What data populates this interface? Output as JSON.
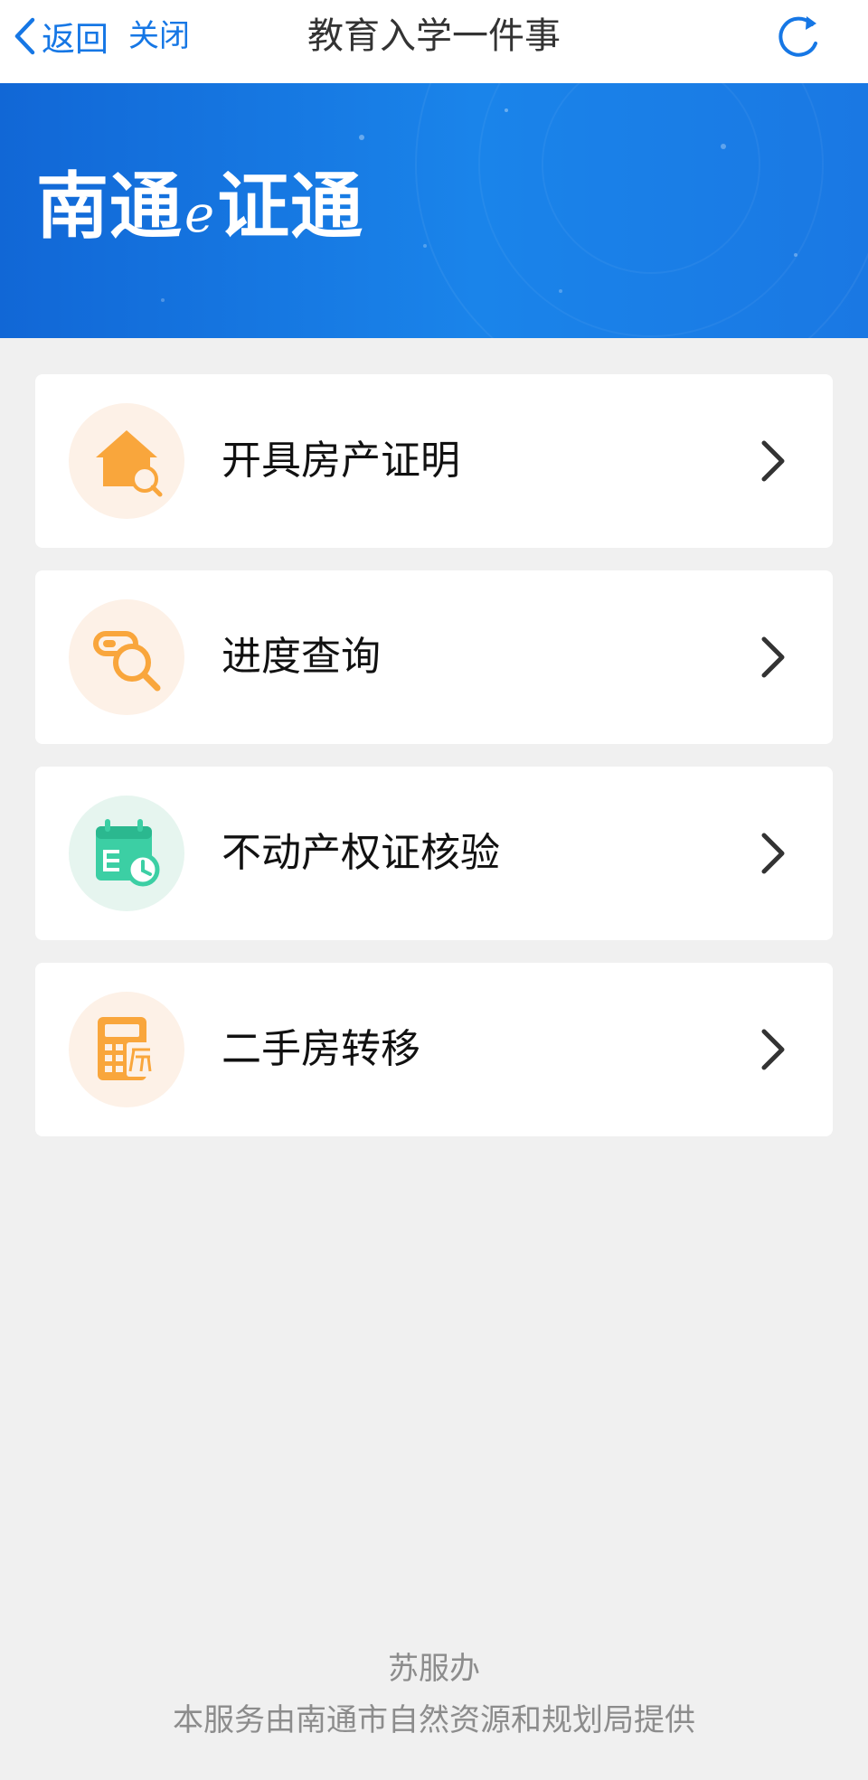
{
  "nav": {
    "back_label": "返回",
    "close_label": "关闭",
    "title": "教育入学一件事"
  },
  "banner": {
    "logo_part1": "南通",
    "logo_e": "e",
    "logo_part2": "证通"
  },
  "menu": [
    {
      "label": "开具房产证明",
      "icon": "house-search-icon"
    },
    {
      "label": "进度查询",
      "icon": "progress-search-icon"
    },
    {
      "label": "不动产权证核验",
      "icon": "calendar-clock-icon"
    },
    {
      "label": "二手房转移",
      "icon": "calculator-house-icon"
    }
  ],
  "footer": {
    "line1": "苏服办",
    "line2": "本服务由南通市自然资源和规划局提供"
  },
  "colors": {
    "accent": "#1677e5",
    "banner": "#1a84ea",
    "orange_icon": "#f9a63c",
    "orange_circle": "#fdf1e7",
    "green_icon": "#3ccfa4",
    "green_circle": "#e6f5ef"
  }
}
